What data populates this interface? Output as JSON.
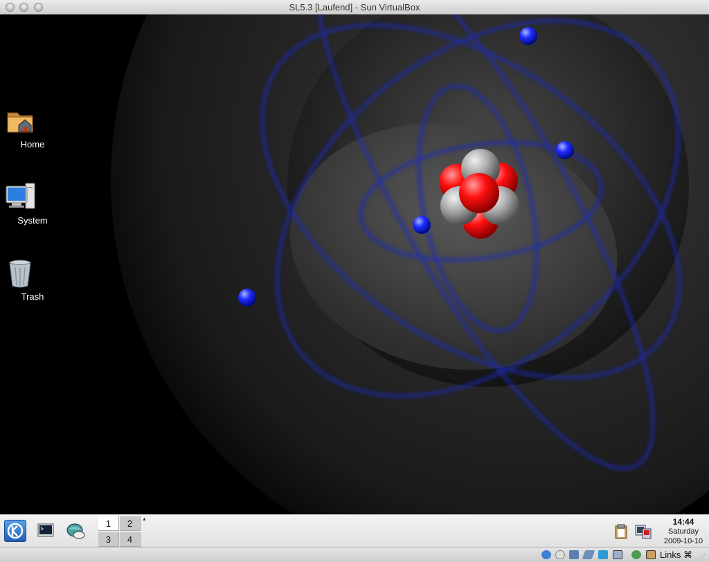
{
  "window": {
    "title": "SL5.3 [Laufend] - Sun VirtualBox"
  },
  "desktop": {
    "icons": [
      {
        "label": "Home",
        "icon": "home-folder-icon"
      },
      {
        "label": "System",
        "icon": "computer-icon"
      },
      {
        "label": "Trash",
        "icon": "trash-icon"
      }
    ]
  },
  "panel": {
    "pager": [
      "1",
      "2",
      "3",
      "4"
    ],
    "active_desktop": "1",
    "clock": {
      "time": "14:44",
      "day": "Saturday",
      "date": "2009-10-10"
    }
  },
  "statusbar": {
    "host_key_label": "Links ⌘"
  }
}
